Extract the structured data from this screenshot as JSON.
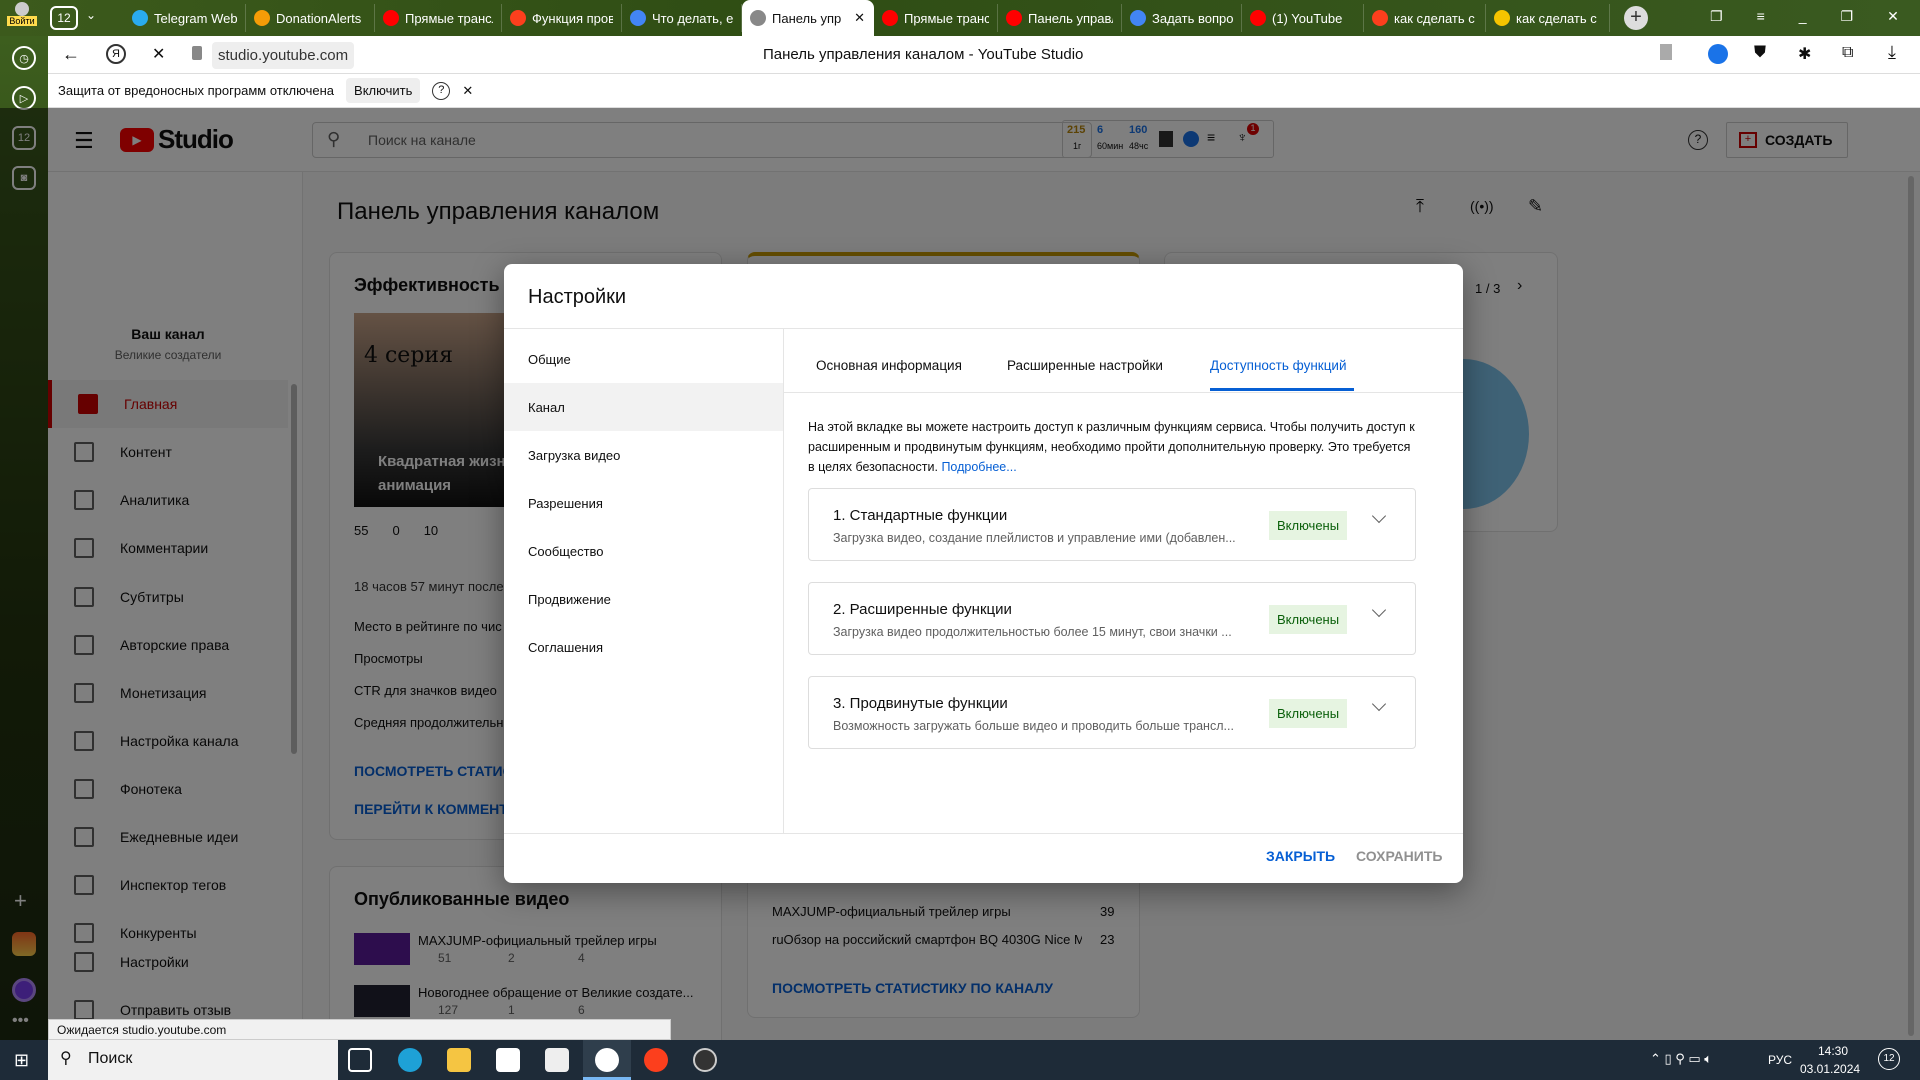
{
  "browser": {
    "tab_count": "12",
    "login": "Войти",
    "tabs": [
      {
        "title": "Telegram Web",
        "color": "#2aabee"
      },
      {
        "title": "DonationAlerts",
        "color": "#f59c07"
      },
      {
        "title": "Прямые трансляции",
        "color": "#ff0000"
      },
      {
        "title": "Функция проверки",
        "color": "#fc3f1d"
      },
      {
        "title": "Что делать, если",
        "color": "#4285f4"
      },
      {
        "title": "Панель упр",
        "color": "#888888",
        "active": true
      },
      {
        "title": "Прямые трансляции",
        "color": "#ff0000"
      },
      {
        "title": "Панель управления",
        "color": "#ff0000"
      },
      {
        "title": "Задать вопрос",
        "color": "#4285f4"
      },
      {
        "title": "(1) YouTube",
        "color": "#ff0000"
      },
      {
        "title": "как сделать с",
        "color": "#fc3f1d"
      },
      {
        "title": "как сделать с",
        "color": "#f5c400"
      }
    ],
    "url": "studio.youtube.com",
    "page_title": "Панель управления каналом - YouTube Studio",
    "infobar": {
      "text": "Защита от вредоносных программ отключена",
      "button": "Включить"
    },
    "status": "Ожидается studio.youtube.com"
  },
  "studio": {
    "logo": "Studio",
    "search_placeholder": "Поиск на канале",
    "stats": {
      "v1": "215",
      "l1": "1г",
      "v2": "6",
      "l2": "60мин",
      "v3": "160",
      "l3": "48чс",
      "badge": "1"
    },
    "create": "СОЗДАТЬ",
    "page_title": "Панель управления каналом",
    "channel": {
      "label": "Ваш канал",
      "name": "Великие создатели"
    },
    "sidebar": [
      {
        "label": "Главная",
        "active": true
      },
      {
        "label": "Контент"
      },
      {
        "label": "Аналитика"
      },
      {
        "label": "Комментарии"
      },
      {
        "label": "Субтитры"
      },
      {
        "label": "Авторские права"
      },
      {
        "label": "Монетизация"
      },
      {
        "label": "Настройка канала"
      },
      {
        "label": "Фонотека"
      },
      {
        "label": "Ежедневные идеи"
      },
      {
        "label": "Инспектор тегов"
      },
      {
        "label": "Конкуренты"
      },
      {
        "label": "Настройки"
      },
      {
        "label": "Отправить отзыв"
      }
    ],
    "perf_card": {
      "title": "Эффективность п",
      "thumb_title": "Квадратная жизнь",
      "thumb_sub": "анимация",
      "thumb_text": "4 серия",
      "views": "55",
      "comments": "0",
      "likes": "10",
      "time": "18 часов 57 минут после",
      "rows": [
        "Место в рейтинге по чис",
        "Просмотры",
        "CTR для значков видео",
        "Средняя продолжительн"
      ],
      "link1": "ПОСМОТРЕТЬ СТАТИС",
      "link2": "ПЕРЕЙТИ К КОММЕНТ"
    },
    "published": {
      "title": "Опубликованные видео",
      "videos": [
        {
          "title": "MAXJUMP-официальный трейлер игры",
          "views": "51",
          "comments": "2",
          "likes": "4"
        },
        {
          "title": "Новогоднее обращение от Великие создате...",
          "views": "127",
          "comments": "1",
          "likes": "6"
        }
      ]
    },
    "top_videos": [
      {
        "title": "MAXJUMP-официальный трейлер игры",
        "value": "39"
      },
      {
        "title": "ruОбзор на российский смартфон BQ 4030G Nice M...",
        "value": "23"
      }
    ],
    "top_link": "ПОСМОТРЕТЬ СТАТИСТИКУ ПО КАНАЛУ",
    "pager": "1 / 3"
  },
  "dialog": {
    "title": "Настройки",
    "nav": [
      {
        "label": "Общие"
      },
      {
        "label": "Канал",
        "selected": true
      },
      {
        "label": "Загрузка видео"
      },
      {
        "label": "Разрешения"
      },
      {
        "label": "Сообщество"
      },
      {
        "label": "Продвижение"
      },
      {
        "label": "Соглашения"
      }
    ],
    "tabs": [
      {
        "label": "Основная информация"
      },
      {
        "label": "Расширенные настройки"
      },
      {
        "label": "Доступность функций",
        "active": true
      }
    ],
    "description": "На этой вкладке вы можете настроить доступ к различным функциям сервиса. Чтобы получить доступ к расширенным и продвинутым функциям, необходимо пройти дополнительную проверку. Это требуется в целях безопасности.",
    "more_link": "Подробнее...",
    "features": [
      {
        "title": "1. Стандартные функции",
        "desc": "Загрузка видео, создание плейлистов и управление ими (добавлен...",
        "status": "Включены"
      },
      {
        "title": "2. Расширенные функции",
        "desc": "Загрузка видео продолжительностью более 15 минут, свои значки ...",
        "status": "Включены"
      },
      {
        "title": "3. Продвинутые функции",
        "desc": "Возможность загружать больше видео и проводить больше трансл...",
        "status": "Включены"
      }
    ],
    "close": "ЗАКРЫТЬ",
    "save": "СОХРАНИТЬ",
    "accent": "#065fd4"
  },
  "taskbar": {
    "search": "Поиск",
    "lang": "РУС",
    "time": "14:30",
    "date": "03.01.2024",
    "notif": "12"
  }
}
